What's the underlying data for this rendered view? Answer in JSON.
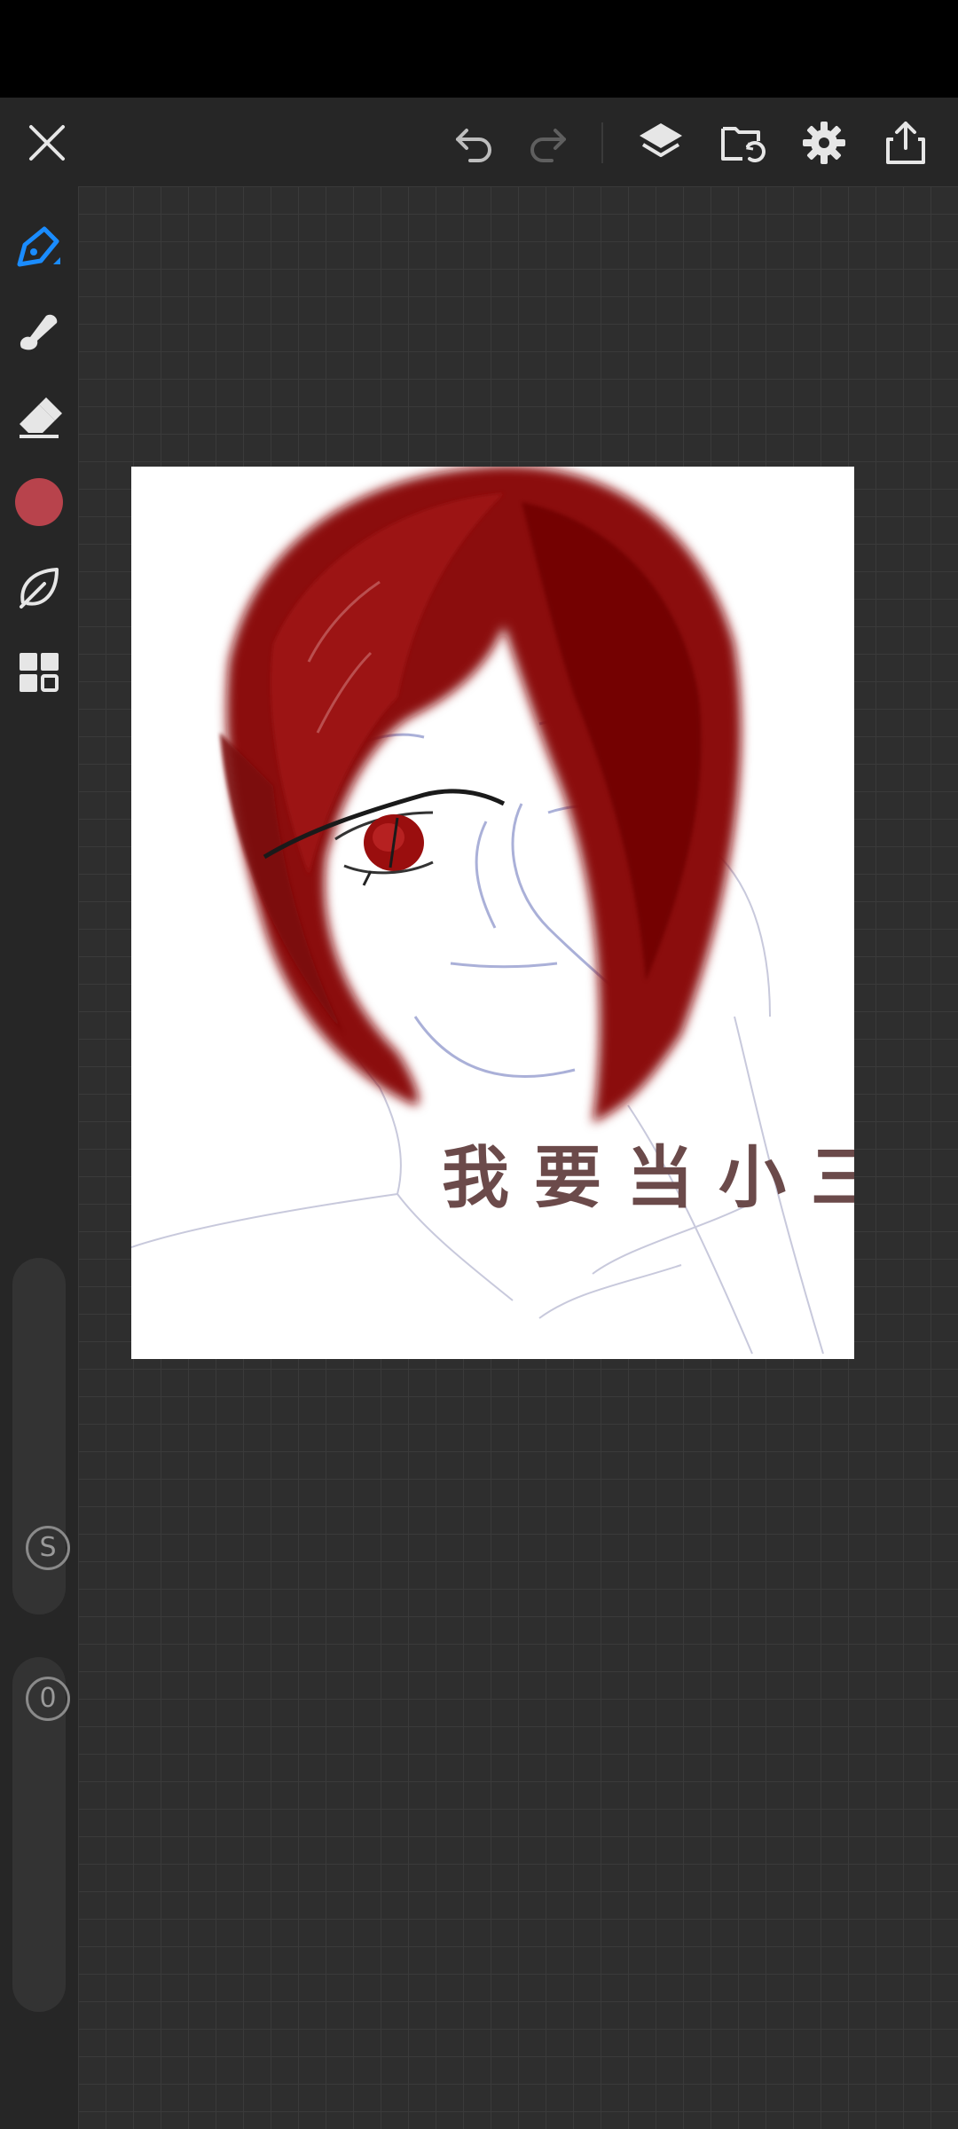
{
  "toolbar": {
    "icons": [
      "close-icon",
      "undo-icon",
      "redo-icon",
      "layers-icon",
      "import-icon",
      "gear-icon",
      "share-icon"
    ]
  },
  "left_toolbar": {
    "tools": [
      "pen-icon",
      "smudge-icon",
      "eraser-icon",
      "color-swatch",
      "leaf-icon",
      "grid-icon"
    ],
    "current_color": "#b8434c",
    "active_tool_color": "#1a8cff",
    "size_slider_label": "S",
    "opacity_slider_label": "0"
  },
  "canvas": {
    "text": "我要当小三",
    "hair_color": "#8b0a0a"
  }
}
